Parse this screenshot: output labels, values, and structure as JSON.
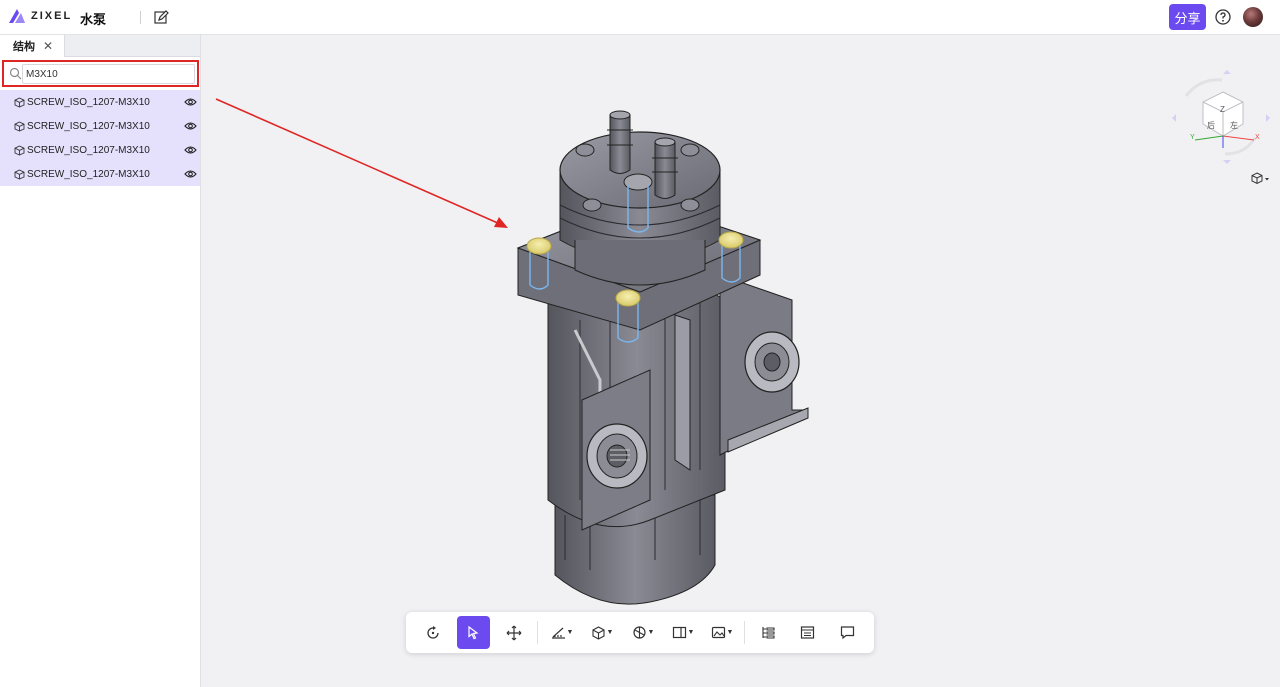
{
  "header": {
    "logo_text": "ZIXEL",
    "doc_title": "水泵",
    "share_label": "分享"
  },
  "sidebar": {
    "tab_label": "结构",
    "search_value": "M3X10",
    "results": [
      {
        "label": "SCREW_ISO_1207-M3X10"
      },
      {
        "label": "SCREW_ISO_1207-M3X10"
      },
      {
        "label": "SCREW_ISO_1207-M3X10"
      },
      {
        "label": "SCREW_ISO_1207-M3X10"
      }
    ]
  },
  "viewcube": {
    "face_top": "Z",
    "face_left": "后",
    "face_right": "左",
    "axis_x": "X",
    "axis_y": "Y",
    "axis_z": "Z"
  },
  "toolbar": {
    "items": [
      {
        "icon": "rotate-icon"
      },
      {
        "icon": "select-icon",
        "active": true
      },
      {
        "icon": "pan-icon"
      },
      {
        "icon": "measure-icon"
      },
      {
        "icon": "explode-icon"
      },
      {
        "icon": "section-icon"
      },
      {
        "icon": "view-icon"
      },
      {
        "icon": "render-icon"
      },
      {
        "icon": "structure-tree-icon"
      },
      {
        "icon": "properties-icon"
      },
      {
        "icon": "comment-icon"
      }
    ]
  },
  "colors": {
    "accent": "#6b4bf0",
    "highlight_border": "#e02525",
    "result_bg": "#e5e0fb",
    "model_gray": "#74747e"
  }
}
